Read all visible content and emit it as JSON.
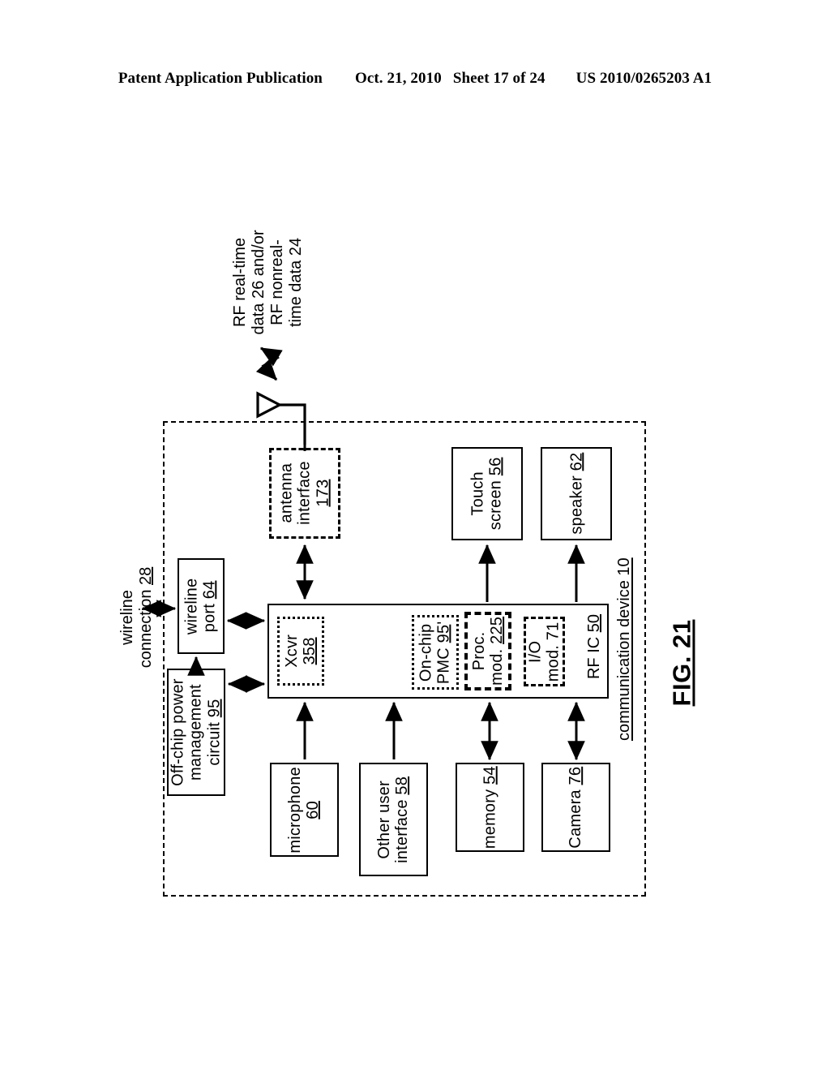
{
  "header": {
    "publication": "Patent Application Publication",
    "date": "Oct. 21, 2010",
    "sheet": "Sheet 17 of 24",
    "patent_number": "US 2010/0265203 A1"
  },
  "figure": {
    "label": "FIG. 21",
    "device_label": "communication device 10",
    "rf_signal_label_line1": "RF real-time",
    "rf_signal_label_line2": "data 26 and/or",
    "rf_signal_label_line3": "RF nonreal-",
    "rf_signal_label_line4": "time data  24",
    "wireline_label_line1": "wireline",
    "wireline_label_line2": "connection ",
    "wireline_label_num": "28"
  },
  "blocks": {
    "antenna_interface": {
      "line1": "antenna",
      "line2": "interface",
      "num": "173",
      "style": "dashed"
    },
    "touch_screen": {
      "line1": "Touch",
      "line2": "screen ",
      "num": "56",
      "style": "solid"
    },
    "speaker": {
      "line1": "speaker ",
      "line2": "",
      "num": "62",
      "style": "solid"
    },
    "wireline_port": {
      "line1": "wireline",
      "line2": "port ",
      "num": "64",
      "style": "solid"
    },
    "offchip_pmc": {
      "line1": "Off-chip power",
      "line2": "management",
      "line3": "circuit ",
      "num": "95",
      "style": "solid"
    },
    "microphone": {
      "line1": "microphone",
      "line2": "",
      "num": "60",
      "style": "solid"
    },
    "other_user_interface": {
      "line1": "Other user",
      "line2": "interface ",
      "num": "58",
      "style": "solid"
    },
    "memory": {
      "line1": "memory ",
      "line2": "",
      "num": "54",
      "style": "solid"
    },
    "camera": {
      "line1": "Camera ",
      "line2": "",
      "num": "76",
      "style": "solid"
    },
    "rf_ic": {
      "label": "RF IC ",
      "num": "50",
      "style": "solid"
    },
    "xcvr": {
      "line1": "Xcvr",
      "line2": "",
      "num": "358",
      "style": "dotted"
    },
    "onchip_pmc": {
      "line1": "On-chip",
      "line2": "PMC ",
      "num": "95",
      "suffix": "'",
      "style": "dotted"
    },
    "proc_mod": {
      "line1": "Proc.",
      "line2": "mod. ",
      "num": "225",
      "style": "dashed-thick"
    },
    "io_mod": {
      "line1": "I/O",
      "line2": "mod. 71",
      "num": "",
      "style": "dashed"
    }
  },
  "colors": {
    "ink": "#000000",
    "paper": "#ffffff"
  }
}
